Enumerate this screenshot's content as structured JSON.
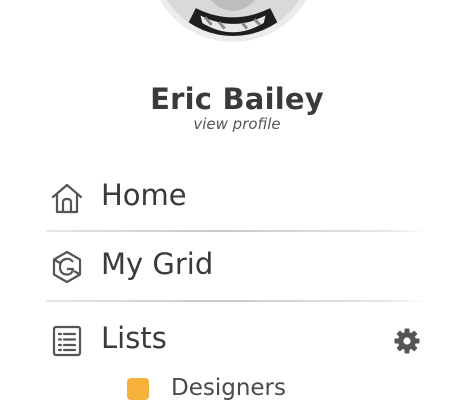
{
  "profile": {
    "name": "Eric Bailey",
    "link_label": "view profile"
  },
  "nav": {
    "home": {
      "label": "Home",
      "icon": "home-icon"
    },
    "grid": {
      "label": "My Grid",
      "icon": "grid-logo-icon"
    },
    "lists": {
      "label": "Lists",
      "icon": "list-icon",
      "settings_icon": "gear-icon"
    }
  },
  "lists": {
    "items": [
      {
        "label": "Designers",
        "color": "#f6b13d"
      }
    ]
  },
  "colors": {
    "text": "#3a3a3a",
    "icon": "#555555",
    "accent_swatch": "#f6b13d"
  }
}
